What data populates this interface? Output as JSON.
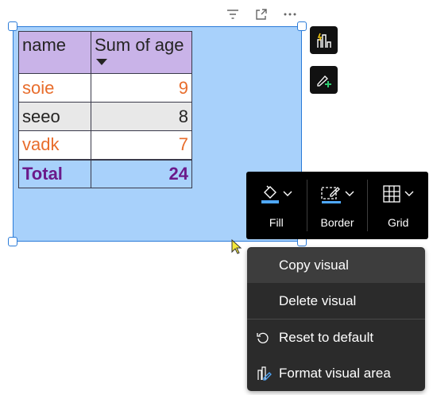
{
  "visual": {
    "table": {
      "headers": [
        "name",
        "Sum of age"
      ],
      "rows": [
        {
          "name": "soie",
          "value": "9"
        },
        {
          "name": "seeo",
          "value": "8"
        },
        {
          "name": "vadk",
          "value": "7"
        }
      ],
      "total": {
        "label": "Total",
        "value": "24"
      }
    }
  },
  "header_icons": [
    "filter-icon",
    "focus-mode-icon",
    "more-options-icon"
  ],
  "side_buttons": [
    "build-visual-icon",
    "format-visual-icon"
  ],
  "format_bar": {
    "items": [
      {
        "label": "Fill",
        "icon": "paint-bucket-icon"
      },
      {
        "label": "Border",
        "icon": "pen-border-icon"
      },
      {
        "label": "Grid",
        "icon": "grid-icon"
      }
    ]
  },
  "context_menu": {
    "items": [
      {
        "label": "Copy visual",
        "icon": ""
      },
      {
        "label": "Delete visual",
        "icon": ""
      },
      {
        "label": "Reset to default",
        "icon": "reset-icon"
      },
      {
        "label": "Format visual area",
        "icon": "format-area-icon"
      }
    ]
  },
  "colors": {
    "visual_bg": "#a8d1fb",
    "header_bg": "#c9b3e8",
    "orange_text": "#e86d2c",
    "total_text": "#6b1a8a",
    "menu_bg": "#2b2b2b"
  }
}
